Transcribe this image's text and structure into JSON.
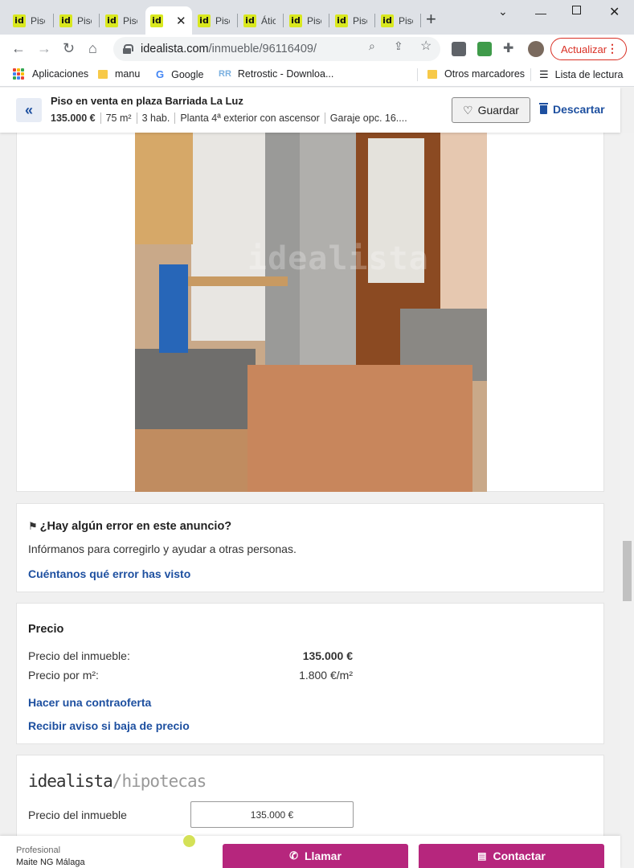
{
  "browser": {
    "tabs": [
      {
        "label": "Piso",
        "favicon": "id"
      },
      {
        "label": "Piso",
        "favicon": "id"
      },
      {
        "label": "Piso",
        "favicon": "id"
      },
      {
        "label": "",
        "favicon": "id",
        "active": true
      },
      {
        "label": "Piso",
        "favicon": "id"
      },
      {
        "label": "Ático",
        "favicon": "id"
      },
      {
        "label": "Piso",
        "favicon": "id"
      },
      {
        "label": "Piso",
        "favicon": "id"
      },
      {
        "label": "Piso",
        "favicon": "id"
      }
    ],
    "url_domain": "idealista.com",
    "url_path": "/inmueble/96116409/",
    "update_label": "Actualizar",
    "bookmarks": {
      "apps": "Aplicaciones",
      "manu": "manu",
      "google": "Google",
      "retrostic": "Retrostic - Downloa...",
      "other": "Otros marcadores",
      "reading_list": "Lista de lectura"
    }
  },
  "header": {
    "title": "Piso en venta en plaza Barriada La Luz",
    "price": "135.000 €",
    "area": "75 m²",
    "rooms": "3 hab.",
    "floor": "Planta 4ª exterior con ascensor",
    "garage": "Garaje opc. 16....",
    "save_label": "Guardar",
    "discard_label": "Descartar"
  },
  "error_report": {
    "title": "¿Hay algún error en este anuncio?",
    "text": "Infórmanos para corregirlo y ayudar a otras personas.",
    "link": "Cuéntanos qué error has visto"
  },
  "price": {
    "title": "Precio",
    "property_label": "Precio del inmueble:",
    "property_value": "135.000 €",
    "per_m2_label": "Precio por m²:",
    "per_m2_value": "1.800 €/m²",
    "counteroffer_link": "Hacer una contraoferta",
    "alert_link": "Recibir aviso si baja de precio"
  },
  "mortgage": {
    "brand": "idealista",
    "brand_suffix": "/hipotecas",
    "property_label": "Precio del inmueble",
    "property_value": "135.000 €"
  },
  "bottom": {
    "pro_label": "Profesional",
    "agency": "Maite NG Málaga",
    "call_label": "Llamar",
    "contact_label": "Contactar"
  },
  "colors": {
    "brand_link": "#1e50a0",
    "cta": "#b6267d",
    "favicon": "#d9e81f"
  }
}
